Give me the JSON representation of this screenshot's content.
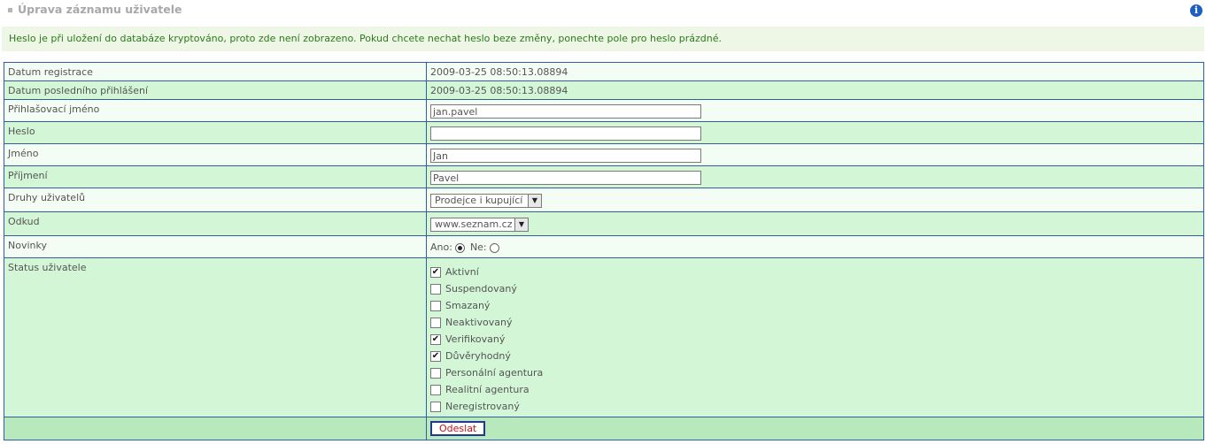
{
  "header": {
    "title": "Úprava záznamu uživatele",
    "info_glyph": "i"
  },
  "notice": "Heslo je při uložení do databáze kryptováno, proto zde není zobrazeno. Pokud chcete nechat heslo beze změny, ponechte pole pro heslo prázdné.",
  "fields": {
    "registration_date": {
      "label": "Datum registrace",
      "value": "2009-03-25 08:50:13.08894"
    },
    "last_login": {
      "label": "Datum posledního přihlášení",
      "value": "2009-03-25 08:50:13.08894"
    },
    "login": {
      "label": "Přihlašovací jméno",
      "value": "jan.pavel"
    },
    "password": {
      "label": "Heslo",
      "value": ""
    },
    "first_name": {
      "label": "Jméno",
      "value": "Jan"
    },
    "last_name": {
      "label": "Příjmení",
      "value": "Pavel"
    },
    "user_type": {
      "label": "Druhy uživatelů",
      "selected": "Prodejce i kupující"
    },
    "source": {
      "label": "Odkud",
      "selected": "www.seznam.cz"
    },
    "news": {
      "label": "Novinky",
      "yes_label": "Ano:",
      "no_label": "Ne:",
      "selected": "Ano"
    },
    "status": {
      "label": "Status uživatele",
      "options": [
        {
          "label": "Aktivní",
          "checked": true
        },
        {
          "label": "Suspendovaný",
          "checked": false
        },
        {
          "label": "Smazaný",
          "checked": false
        },
        {
          "label": "Neaktivovaný",
          "checked": false
        },
        {
          "label": "Verifikovaný",
          "checked": true
        },
        {
          "label": "Důvěryhodný",
          "checked": true
        },
        {
          "label": "Personální agentura",
          "checked": false
        },
        {
          "label": "Realitní agentura",
          "checked": false
        },
        {
          "label": "Neregistrovaný",
          "checked": false
        }
      ]
    }
  },
  "submit_label": "Odeslat",
  "colors": {
    "border": "#2f5f9f",
    "row_light": "#f4fdf4",
    "row_green": "#d3f6d7",
    "notice_text": "#2b7a1b",
    "submit_text": "#c4141c"
  }
}
